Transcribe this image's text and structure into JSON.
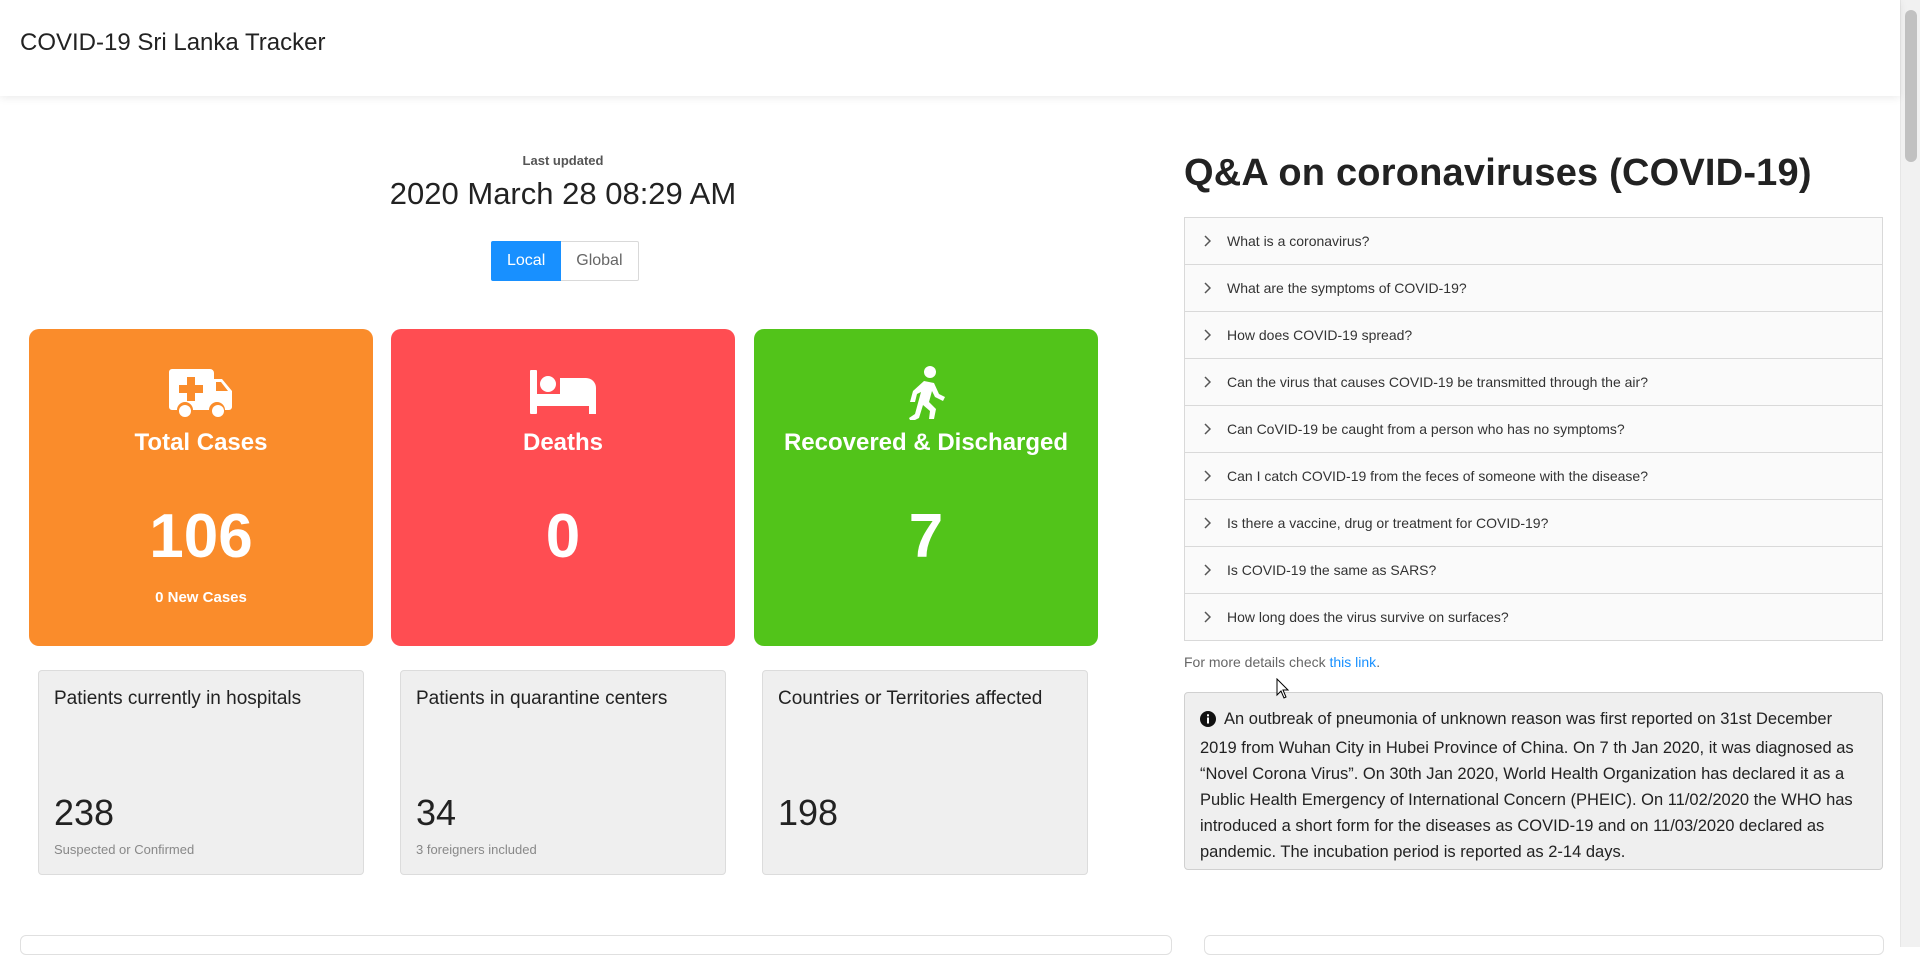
{
  "app": {
    "title": "COVID-19 Sri Lanka Tracker"
  },
  "updated": {
    "label": "Last updated",
    "time": "2020 March 28 08:29 AM"
  },
  "toggle": {
    "local": "Local",
    "global": "Global",
    "selected": "Local"
  },
  "stats": [
    {
      "title": "Total Cases",
      "value": "106",
      "sub": "0 New Cases",
      "color": "#fa8c2b",
      "icon": "ambulance-icon"
    },
    {
      "title": "Deaths",
      "value": "0",
      "sub": "",
      "color": "#ff4d52",
      "icon": "bed-icon"
    },
    {
      "title": "Recovered & Discharged",
      "value": "7",
      "sub": "",
      "color": "#52c41a",
      "icon": "walking-icon"
    }
  ],
  "info_cards": [
    {
      "title": "Patients currently in hospitals",
      "value": "238",
      "note": "Suspected or Confirmed"
    },
    {
      "title": "Patients in quarantine centers",
      "value": "34",
      "note": "3 foreigners included"
    },
    {
      "title": "Countries or Territories affected",
      "value": "198",
      "note": ""
    }
  ],
  "qa": {
    "title": "Q&A on coronaviruses (COVID-19)",
    "questions": [
      "What is a coronavirus?",
      "What are the symptoms of COVID-19?",
      "How does COVID-19 spread?",
      "Can the virus that causes COVID-19 be transmitted through the air?",
      "Can CoVID-19 be caught from a person who has no symptoms?",
      "Can I catch COVID-19 from the feces of someone with the disease?",
      "Is there a vaccine, drug or treatment for COVID-19?",
      "Is COVID-19 the same as SARS?",
      "How long does the virus survive on surfaces?"
    ],
    "more_prefix": "For more details check ",
    "more_link": "this link",
    "more_suffix": "."
  },
  "alert": {
    "text": "An outbreak of pneumonia of unknown reason was first reported on 31st December 2019 from Wuhan City in Hubei Province of China. On 7 th Jan 2020, it was diagnosed as “Novel Corona Virus”. On 30th Jan 2020, World Health Organization has declared it as a Public Health Emergency of International Concern (PHEIC). On 11/02/2020 the WHO has introduced a short form for the diseases as COVID-19 and on 11/03/2020 declared as pandemic. The incubation period is reported as 2-14 days."
  },
  "colors": {
    "accent": "#1890ff",
    "orange": "#fa8c2b",
    "red": "#ff4d52",
    "green": "#52c41a"
  }
}
